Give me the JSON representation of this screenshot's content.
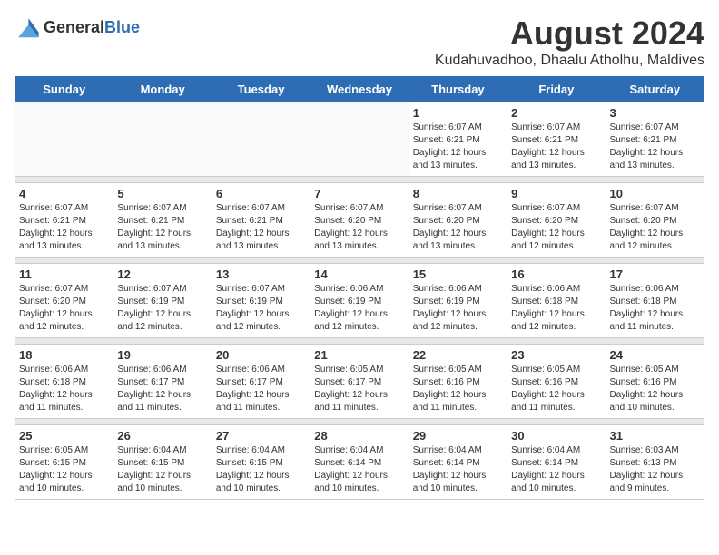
{
  "header": {
    "logo_general": "General",
    "logo_blue": "Blue",
    "main_title": "August 2024",
    "subtitle": "Kudahuvadhoo, Dhaalu Atholhu, Maldives"
  },
  "calendar": {
    "days_of_week": [
      "Sunday",
      "Monday",
      "Tuesday",
      "Wednesday",
      "Thursday",
      "Friday",
      "Saturday"
    ],
    "weeks": [
      {
        "days": [
          {
            "number": "",
            "info": "",
            "empty": true
          },
          {
            "number": "",
            "info": "",
            "empty": true
          },
          {
            "number": "",
            "info": "",
            "empty": true
          },
          {
            "number": "",
            "info": "",
            "empty": true
          },
          {
            "number": "1",
            "info": "Sunrise: 6:07 AM\nSunset: 6:21 PM\nDaylight: 12 hours\nand 13 minutes."
          },
          {
            "number": "2",
            "info": "Sunrise: 6:07 AM\nSunset: 6:21 PM\nDaylight: 12 hours\nand 13 minutes."
          },
          {
            "number": "3",
            "info": "Sunrise: 6:07 AM\nSunset: 6:21 PM\nDaylight: 12 hours\nand 13 minutes."
          }
        ]
      },
      {
        "days": [
          {
            "number": "4",
            "info": "Sunrise: 6:07 AM\nSunset: 6:21 PM\nDaylight: 12 hours\nand 13 minutes."
          },
          {
            "number": "5",
            "info": "Sunrise: 6:07 AM\nSunset: 6:21 PM\nDaylight: 12 hours\nand 13 minutes."
          },
          {
            "number": "6",
            "info": "Sunrise: 6:07 AM\nSunset: 6:21 PM\nDaylight: 12 hours\nand 13 minutes."
          },
          {
            "number": "7",
            "info": "Sunrise: 6:07 AM\nSunset: 6:20 PM\nDaylight: 12 hours\nand 13 minutes."
          },
          {
            "number": "8",
            "info": "Sunrise: 6:07 AM\nSunset: 6:20 PM\nDaylight: 12 hours\nand 13 minutes."
          },
          {
            "number": "9",
            "info": "Sunrise: 6:07 AM\nSunset: 6:20 PM\nDaylight: 12 hours\nand 12 minutes."
          },
          {
            "number": "10",
            "info": "Sunrise: 6:07 AM\nSunset: 6:20 PM\nDaylight: 12 hours\nand 12 minutes."
          }
        ]
      },
      {
        "days": [
          {
            "number": "11",
            "info": "Sunrise: 6:07 AM\nSunset: 6:20 PM\nDaylight: 12 hours\nand 12 minutes."
          },
          {
            "number": "12",
            "info": "Sunrise: 6:07 AM\nSunset: 6:19 PM\nDaylight: 12 hours\nand 12 minutes."
          },
          {
            "number": "13",
            "info": "Sunrise: 6:07 AM\nSunset: 6:19 PM\nDaylight: 12 hours\nand 12 minutes."
          },
          {
            "number": "14",
            "info": "Sunrise: 6:06 AM\nSunset: 6:19 PM\nDaylight: 12 hours\nand 12 minutes."
          },
          {
            "number": "15",
            "info": "Sunrise: 6:06 AM\nSunset: 6:19 PM\nDaylight: 12 hours\nand 12 minutes."
          },
          {
            "number": "16",
            "info": "Sunrise: 6:06 AM\nSunset: 6:18 PM\nDaylight: 12 hours\nand 12 minutes."
          },
          {
            "number": "17",
            "info": "Sunrise: 6:06 AM\nSunset: 6:18 PM\nDaylight: 12 hours\nand 11 minutes."
          }
        ]
      },
      {
        "days": [
          {
            "number": "18",
            "info": "Sunrise: 6:06 AM\nSunset: 6:18 PM\nDaylight: 12 hours\nand 11 minutes."
          },
          {
            "number": "19",
            "info": "Sunrise: 6:06 AM\nSunset: 6:17 PM\nDaylight: 12 hours\nand 11 minutes."
          },
          {
            "number": "20",
            "info": "Sunrise: 6:06 AM\nSunset: 6:17 PM\nDaylight: 12 hours\nand 11 minutes."
          },
          {
            "number": "21",
            "info": "Sunrise: 6:05 AM\nSunset: 6:17 PM\nDaylight: 12 hours\nand 11 minutes."
          },
          {
            "number": "22",
            "info": "Sunrise: 6:05 AM\nSunset: 6:16 PM\nDaylight: 12 hours\nand 11 minutes."
          },
          {
            "number": "23",
            "info": "Sunrise: 6:05 AM\nSunset: 6:16 PM\nDaylight: 12 hours\nand 11 minutes."
          },
          {
            "number": "24",
            "info": "Sunrise: 6:05 AM\nSunset: 6:16 PM\nDaylight: 12 hours\nand 10 minutes."
          }
        ]
      },
      {
        "days": [
          {
            "number": "25",
            "info": "Sunrise: 6:05 AM\nSunset: 6:15 PM\nDaylight: 12 hours\nand 10 minutes."
          },
          {
            "number": "26",
            "info": "Sunrise: 6:04 AM\nSunset: 6:15 PM\nDaylight: 12 hours\nand 10 minutes."
          },
          {
            "number": "27",
            "info": "Sunrise: 6:04 AM\nSunset: 6:15 PM\nDaylight: 12 hours\nand 10 minutes."
          },
          {
            "number": "28",
            "info": "Sunrise: 6:04 AM\nSunset: 6:14 PM\nDaylight: 12 hours\nand 10 minutes."
          },
          {
            "number": "29",
            "info": "Sunrise: 6:04 AM\nSunset: 6:14 PM\nDaylight: 12 hours\nand 10 minutes."
          },
          {
            "number": "30",
            "info": "Sunrise: 6:04 AM\nSunset: 6:14 PM\nDaylight: 12 hours\nand 10 minutes."
          },
          {
            "number": "31",
            "info": "Sunrise: 6:03 AM\nSunset: 6:13 PM\nDaylight: 12 hours\nand 9 minutes."
          }
        ]
      }
    ]
  }
}
